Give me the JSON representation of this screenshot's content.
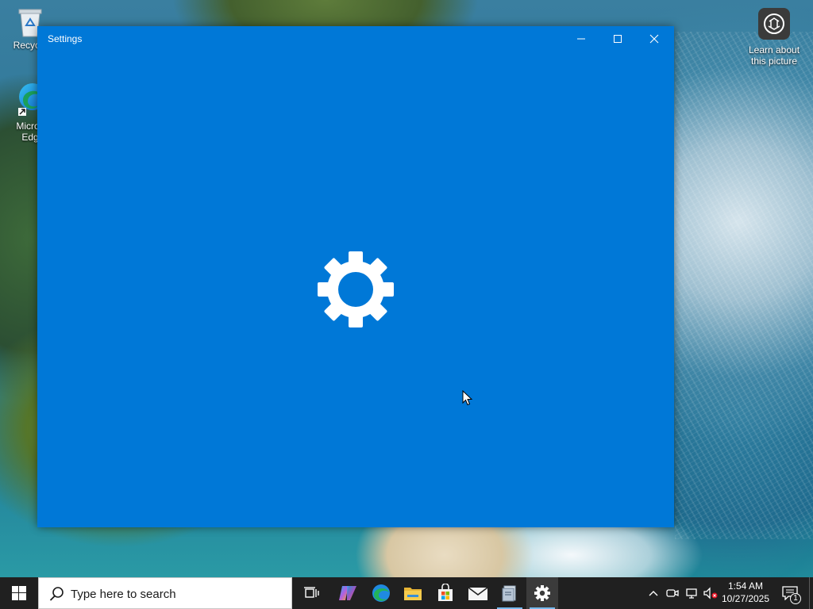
{
  "desktop": {
    "icons": [
      {
        "label": "Recycle",
        "icon": "recycle-bin-icon"
      },
      {
        "label": "Micros",
        "label2": "Edg",
        "icon": "edge-icon"
      },
      {
        "label": "Learn about",
        "label2": "this picture",
        "icon": "camera-icon"
      }
    ]
  },
  "window": {
    "title": "Settings",
    "accent": "#0078d7",
    "splash_icon": "gear-icon"
  },
  "taskbar": {
    "search_placeholder": "Type here to search",
    "apps": [
      {
        "name": "task-view",
        "icon": "task-view-icon"
      },
      {
        "name": "copilot",
        "icon": "copilot-icon"
      },
      {
        "name": "edge",
        "icon": "edge-icon"
      },
      {
        "name": "file-explorer",
        "icon": "folder-icon"
      },
      {
        "name": "store",
        "icon": "store-icon"
      },
      {
        "name": "mail",
        "icon": "mail-icon"
      },
      {
        "name": "notepad-app",
        "icon": "app-icon"
      },
      {
        "name": "settings",
        "icon": "gear-icon",
        "active": true
      }
    ],
    "clock": {
      "time": "1:54 AM",
      "date": "10/27/2025"
    },
    "notifications_count": "1",
    "bg": "#202020"
  }
}
